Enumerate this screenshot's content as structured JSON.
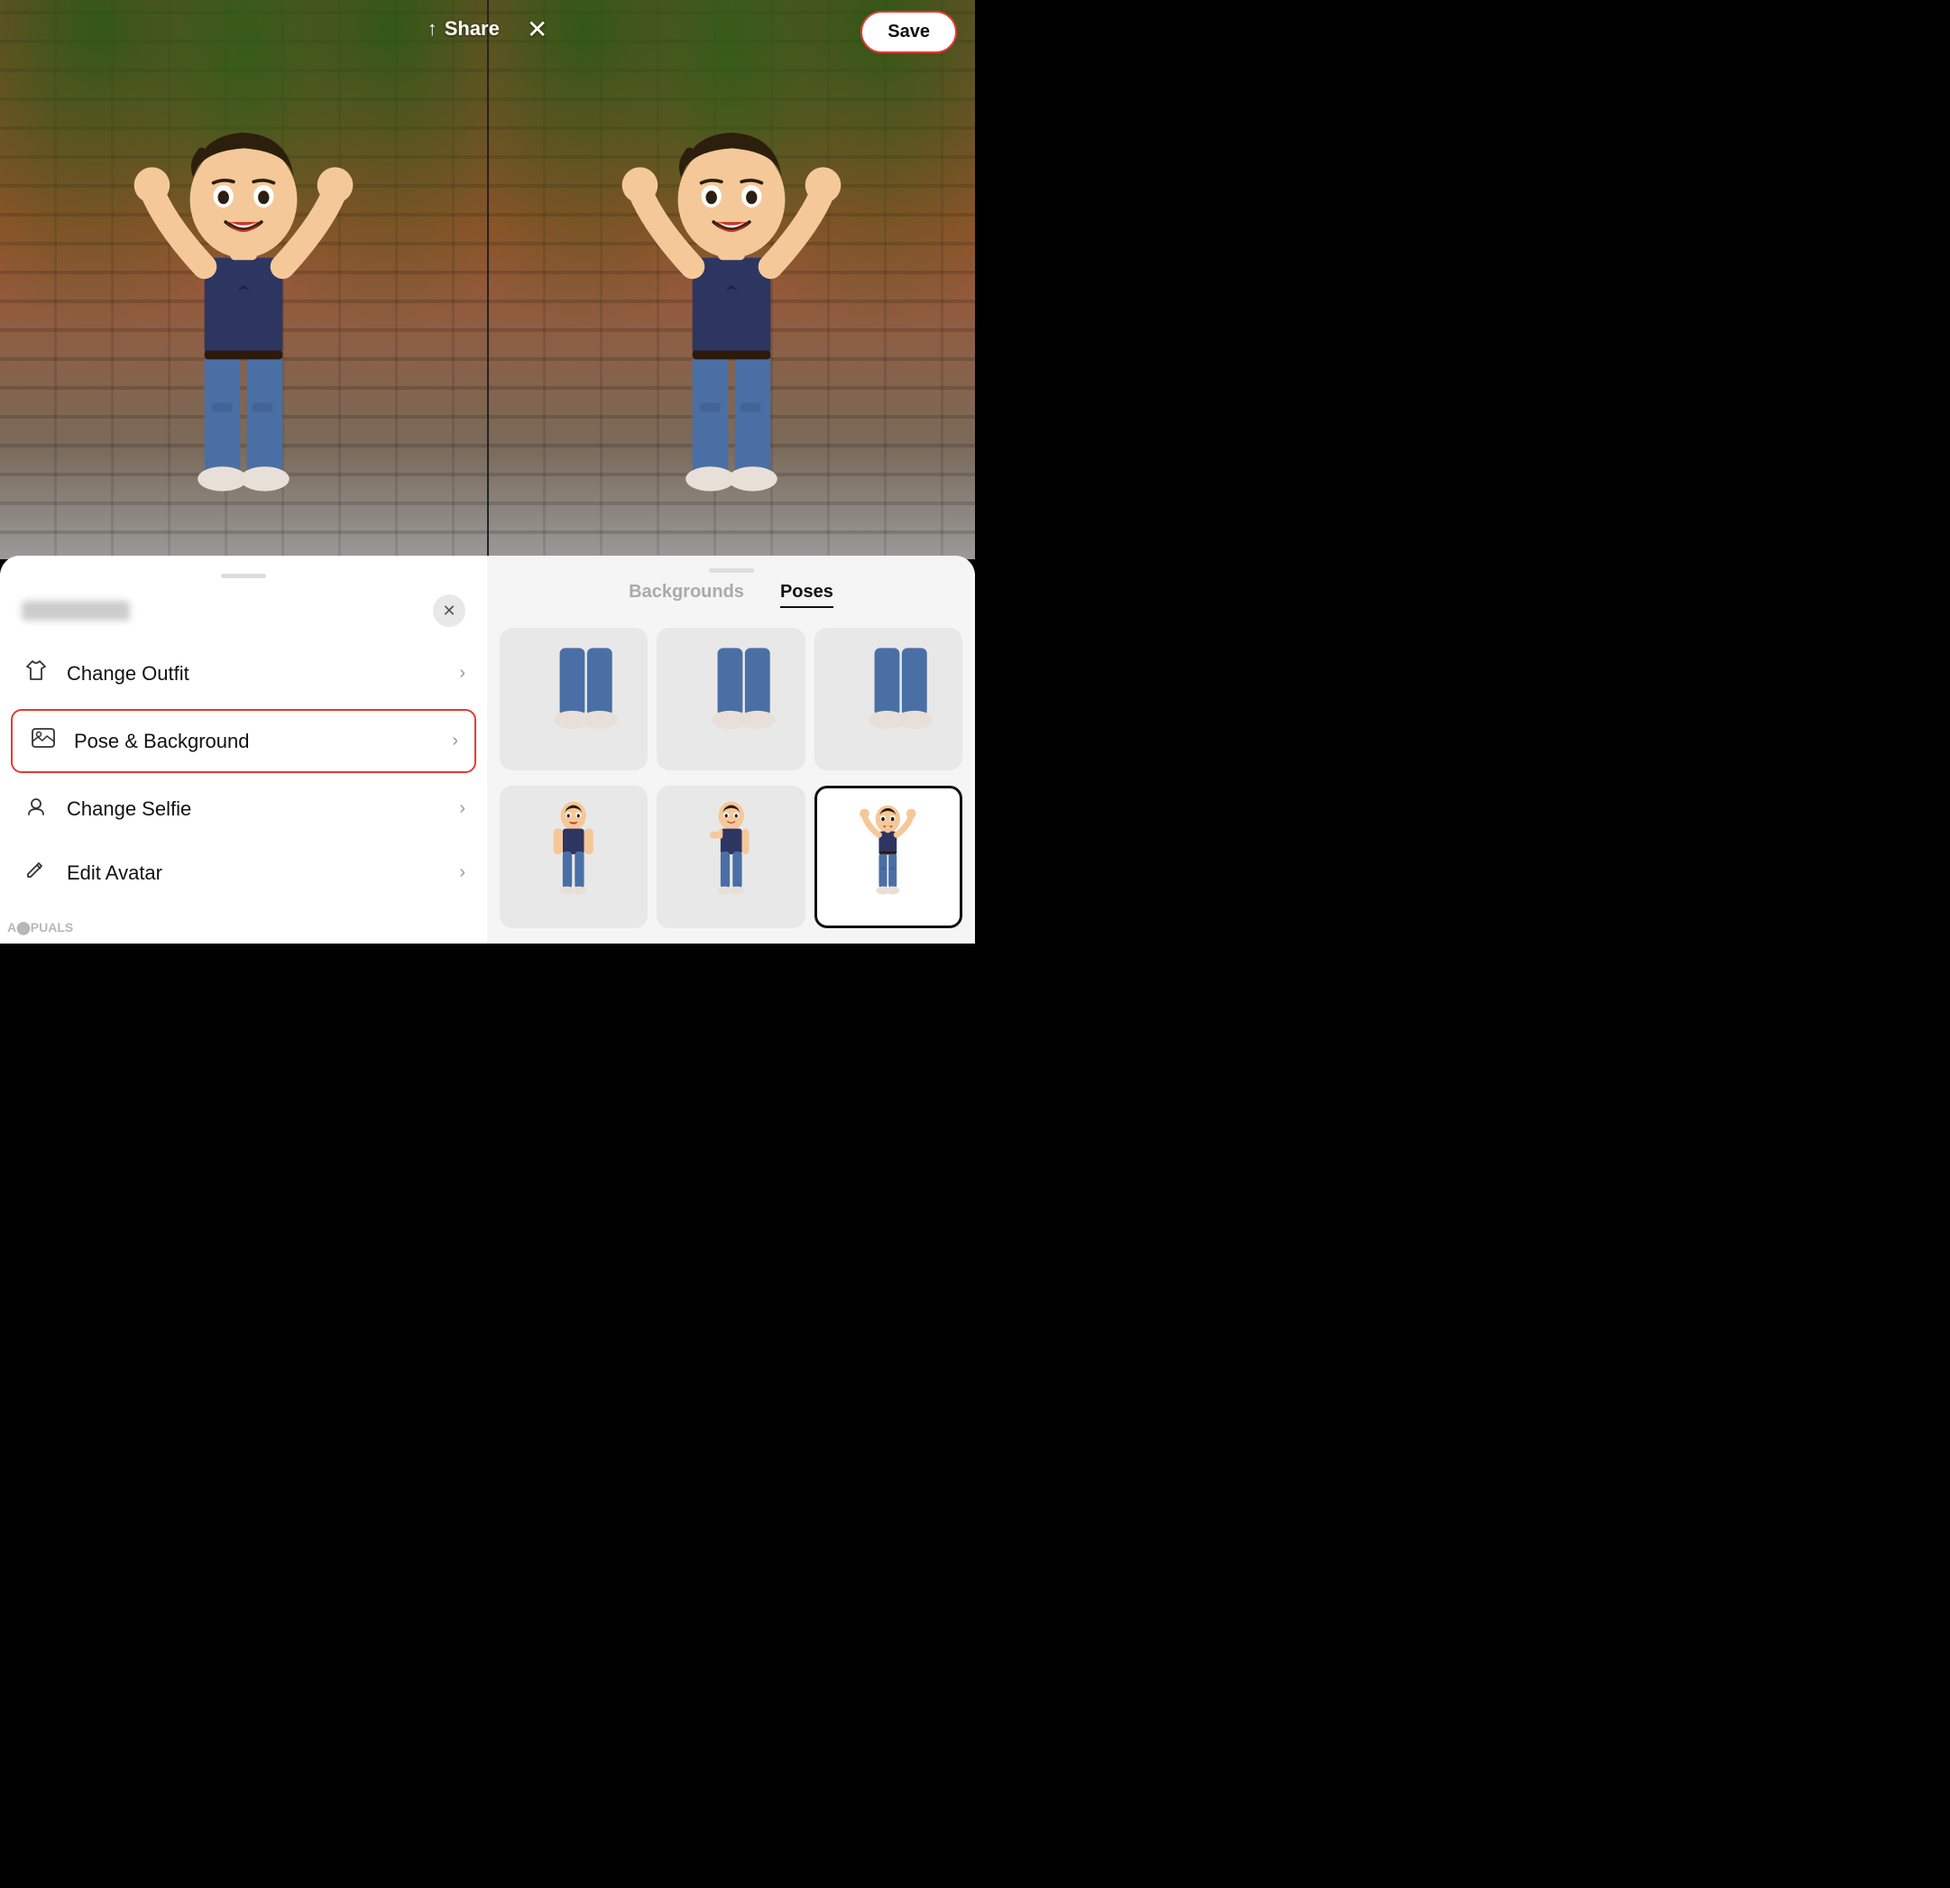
{
  "header": {
    "share_label": "Share",
    "save_label": "Save"
  },
  "tabs": {
    "backgrounds_label": "Backgrounds",
    "poses_label": "Poses",
    "active_tab": "poses"
  },
  "left_menu": {
    "user_name": "User Name",
    "change_outfit_label": "Change Outfit",
    "pose_background_label": "Pose & Background",
    "change_selfie_label": "Change Selfie",
    "edit_avatar_label": "Edit Avatar"
  },
  "poses": [
    {
      "id": 1,
      "selected": false,
      "label": "pose-legs-only-1"
    },
    {
      "id": 2,
      "selected": false,
      "label": "pose-legs-only-2"
    },
    {
      "id": 3,
      "selected": false,
      "label": "pose-legs-only-3"
    },
    {
      "id": 4,
      "selected": false,
      "label": "pose-standing-1"
    },
    {
      "id": 5,
      "selected": false,
      "label": "pose-standing-2"
    },
    {
      "id": 6,
      "selected": true,
      "label": "pose-power-flex"
    }
  ],
  "icons": {
    "share": "↑",
    "close": "✕",
    "outfit": "👕",
    "pose_bg": "🖼",
    "selfie": "👤",
    "edit": "✏️",
    "chevron": "›"
  }
}
